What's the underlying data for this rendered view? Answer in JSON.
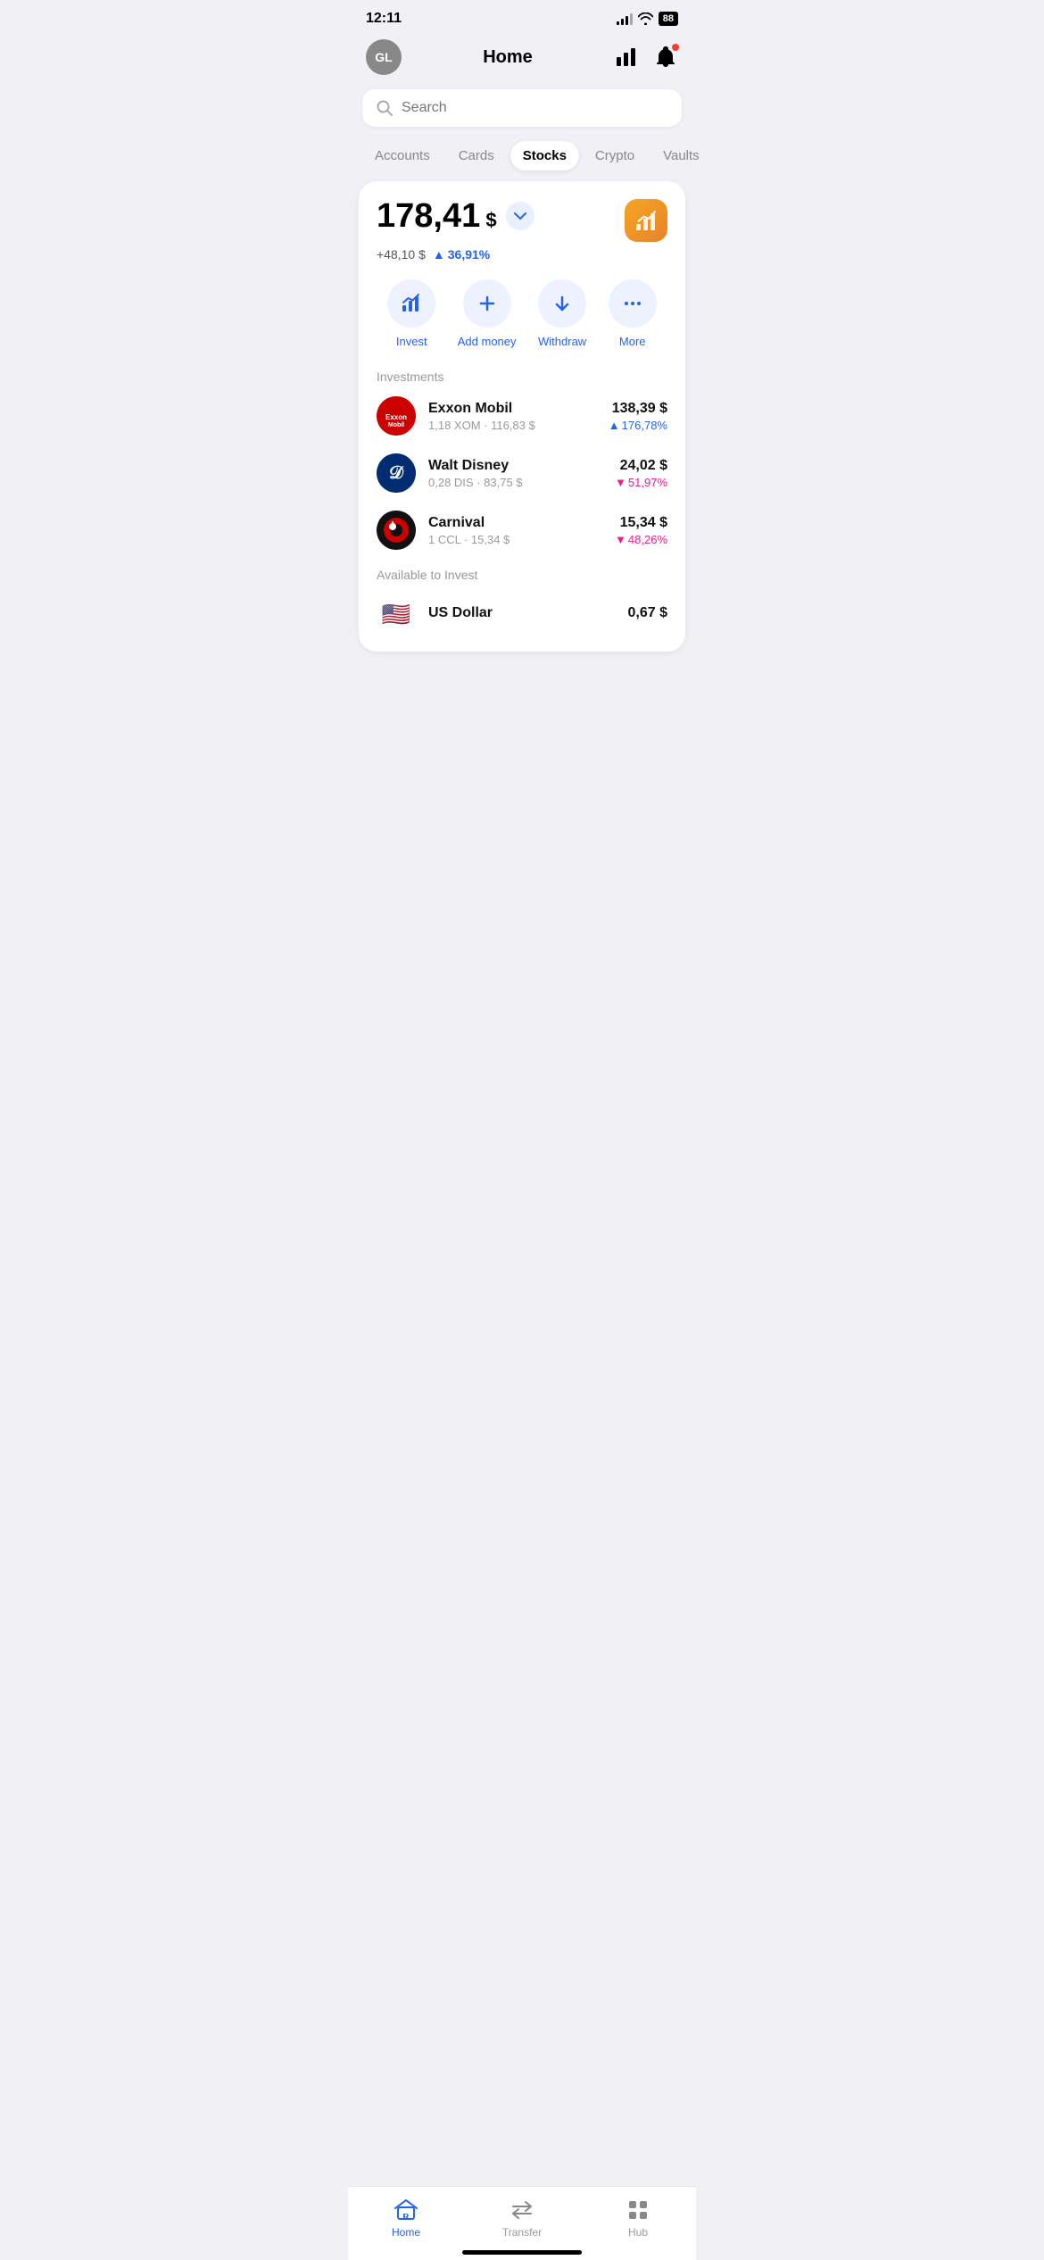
{
  "statusBar": {
    "time": "12:11",
    "battery": "88"
  },
  "header": {
    "avatarInitials": "GL",
    "title": "Home"
  },
  "search": {
    "placeholder": "Search"
  },
  "tabs": [
    {
      "id": "accounts",
      "label": "Accounts",
      "active": false
    },
    {
      "id": "cards",
      "label": "Cards",
      "active": false
    },
    {
      "id": "stocks",
      "label": "Stocks",
      "active": true
    },
    {
      "id": "crypto",
      "label": "Crypto",
      "active": false
    },
    {
      "id": "vaults",
      "label": "Vaults",
      "active": false
    }
  ],
  "portfolio": {
    "balanceMain": "178,41",
    "balanceCurrency": "$",
    "changeAmount": "+48,10 $",
    "changePercent": "36,91%"
  },
  "actions": [
    {
      "id": "invest",
      "label": "Invest"
    },
    {
      "id": "add-money",
      "label": "Add money"
    },
    {
      "id": "withdraw",
      "label": "Withdraw"
    },
    {
      "id": "more",
      "label": "More"
    }
  ],
  "investmentsLabel": "Investments",
  "investments": [
    {
      "id": "exxon",
      "name": "Exxon Mobil",
      "detail": "1,18 XOM · 116,83 $",
      "amount": "138,39 $",
      "change": "176,78%",
      "changeDir": "up"
    },
    {
      "id": "disney",
      "name": "Walt Disney",
      "detail": "0,28 DIS · 83,75 $",
      "amount": "24,02 $",
      "change": "51,97%",
      "changeDir": "down"
    },
    {
      "id": "carnival",
      "name": "Carnival",
      "detail": "1 CCL · 15,34 $",
      "amount": "15,34 $",
      "change": "48,26%",
      "changeDir": "down"
    }
  ],
  "availableLabel": "Available to Invest",
  "availableItems": [
    {
      "id": "usd",
      "name": "US Dollar",
      "amount": "0,67 $"
    }
  ],
  "bottomNav": [
    {
      "id": "home",
      "label": "Home",
      "active": true
    },
    {
      "id": "transfer",
      "label": "Transfer",
      "active": false
    },
    {
      "id": "hub",
      "label": "Hub",
      "active": false
    }
  ]
}
